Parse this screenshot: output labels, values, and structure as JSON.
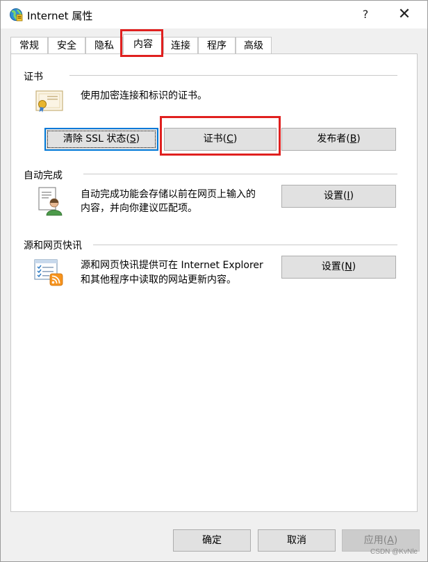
{
  "window": {
    "title": "Internet 属性",
    "help": "?",
    "close": "✕"
  },
  "tabs": [
    {
      "label": "常规"
    },
    {
      "label": "安全"
    },
    {
      "label": "隐私"
    },
    {
      "label": "内容"
    },
    {
      "label": "连接"
    },
    {
      "label": "程序"
    },
    {
      "label": "高级"
    }
  ],
  "certificates": {
    "group_label": "证书",
    "description": "使用加密连接和标识的证书。",
    "clear_ssl_button": {
      "text": "清除 SSL 状态(",
      "key": "S",
      "end": ")"
    },
    "certificates_button": {
      "text": "证书(",
      "key": "C",
      "end": ")"
    },
    "publishers_button": {
      "text": "发布者(",
      "key": "B",
      "end": ")"
    }
  },
  "autocomplete": {
    "group_label": "自动完成",
    "description_line1": "自动完成功能会存储以前在网页上输入的",
    "description_line2": "内容，并向你建议匹配项。",
    "settings_button": {
      "text": "设置(",
      "key": "I",
      "end": ")"
    }
  },
  "feeds": {
    "group_label": "源和网页快讯",
    "description_line1": "源和网页快讯提供可在 Internet Explorer",
    "description_line2": "和其他程序中读取的网站更新内容。",
    "settings_button": {
      "text": "设置(",
      "key": "N",
      "end": ")"
    }
  },
  "footer": {
    "ok": "确定",
    "cancel": "取消",
    "apply": {
      "text": "应用(",
      "key": "A",
      "end": ")"
    }
  },
  "watermark": "CSDN @KvNle",
  "colors": {
    "highlight_red": "#e0201f",
    "focus_blue": "#0078d7",
    "button_face": "#e1e1e1"
  }
}
